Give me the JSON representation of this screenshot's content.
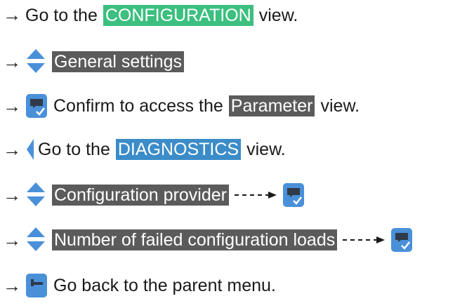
{
  "steps": [
    {
      "arrow": "→",
      "before": "Go to the",
      "highlight": "CONFIGURATION",
      "after": "view.",
      "highlight_color": "#3cbf7f"
    },
    {
      "arrow": "→",
      "icon": "up-down-arrows-icon",
      "highlight": "General settings",
      "highlight_color": "#5b5b5b"
    },
    {
      "arrow": "→",
      "icon": "confirm-icon",
      "before": "Confirm to access the",
      "highlight": "Parameter",
      "after": "view.",
      "highlight_color": "#5b5b5b"
    },
    {
      "arrow": "→",
      "icon": "left-arrow-icon",
      "before": "Go to the",
      "highlight": "DIAGNOSTICS",
      "after": "view.",
      "highlight_color": "#3b8cc9"
    },
    {
      "arrow": "→",
      "icon": "up-down-arrows-icon",
      "highlight": "Configuration provider",
      "trail_icon": "confirm-icon",
      "highlight_color": "#5b5b5b"
    },
    {
      "arrow": "→",
      "icon": "up-down-arrows-icon",
      "highlight": "Number of failed configuration loads",
      "trail_icon": "confirm-icon",
      "highlight_color": "#5b5b5b"
    },
    {
      "arrow": "→",
      "icon": "back-icon",
      "before": "Go back to the parent menu."
    }
  ],
  "colors": {
    "icon_blue": "#4a90d9",
    "icon_dark": "#2f3a4a"
  }
}
